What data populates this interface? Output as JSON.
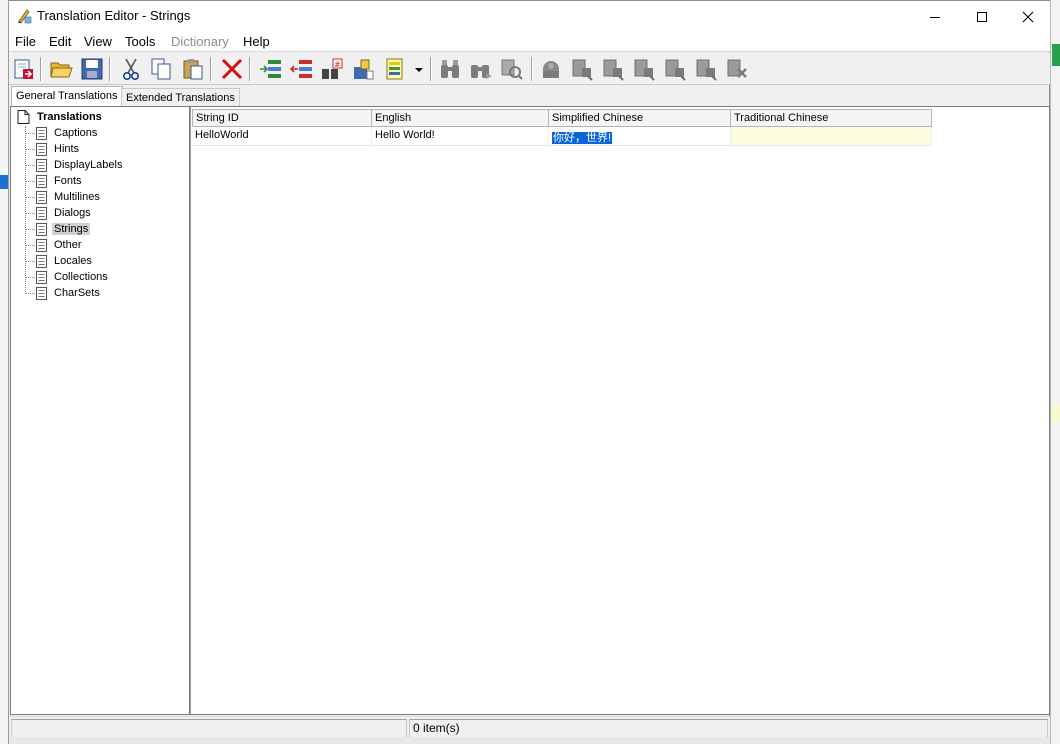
{
  "window": {
    "title": "Translation Editor - Strings",
    "minimize": "—",
    "maximize": "☐",
    "close": "✕"
  },
  "menu": [
    {
      "label": "File",
      "enabled": true
    },
    {
      "label": "Edit",
      "enabled": true
    },
    {
      "label": "View",
      "enabled": true
    },
    {
      "label": "Tools",
      "enabled": true
    },
    {
      "label": "Dictionary",
      "enabled": false
    },
    {
      "label": "Help",
      "enabled": true
    }
  ],
  "toolbar": {
    "buttons": [
      {
        "icon": "exit-icon",
        "enabled": true
      },
      {
        "icon": "open-folder-icon",
        "enabled": true
      },
      {
        "icon": "save-icon",
        "enabled": true
      },
      {
        "icon": "cut-icon",
        "enabled": true
      },
      {
        "icon": "copy-icon",
        "enabled": true
      },
      {
        "icon": "paste-icon",
        "enabled": true
      },
      {
        "icon": "delete-icon",
        "enabled": true
      },
      {
        "icon": "add-item-icon",
        "enabled": true
      },
      {
        "icon": "remove-item-icon",
        "enabled": true
      },
      {
        "icon": "replace-icon",
        "enabled": true
      },
      {
        "icon": "clear-icon",
        "enabled": true
      },
      {
        "icon": "highlight-dropdown-icon",
        "enabled": true
      },
      {
        "icon": "find-icon",
        "enabled": false
      },
      {
        "icon": "find-next-icon",
        "enabled": false
      },
      {
        "icon": "find-replace-icon",
        "enabled": false
      },
      {
        "icon": "translate-icon",
        "enabled": false
      },
      {
        "icon": "translate-row-icon",
        "enabled": false
      },
      {
        "icon": "translate-column-icon",
        "enabled": false
      },
      {
        "icon": "translate-all-icon",
        "enabled": false
      },
      {
        "icon": "translate-selection-icon",
        "enabled": false
      },
      {
        "icon": "translate-next-icon",
        "enabled": false
      },
      {
        "icon": "translate-clear-icon",
        "enabled": false
      }
    ]
  },
  "tabs": [
    {
      "label": "General Translations",
      "active": true
    },
    {
      "label": "Extended Translations",
      "active": false
    }
  ],
  "tree": {
    "root": "Translations",
    "items": [
      {
        "label": "Captions",
        "selected": false
      },
      {
        "label": "Hints",
        "selected": false
      },
      {
        "label": "DisplayLabels",
        "selected": false
      },
      {
        "label": "Fonts",
        "selected": false
      },
      {
        "label": "Multilines",
        "selected": false
      },
      {
        "label": "Dialogs",
        "selected": false
      },
      {
        "label": "Strings",
        "selected": true
      },
      {
        "label": "Other",
        "selected": false
      },
      {
        "label": "Locales",
        "selected": false
      },
      {
        "label": "Collections",
        "selected": false
      },
      {
        "label": "CharSets",
        "selected": false
      }
    ]
  },
  "grid": {
    "columns": [
      "String ID",
      "English",
      "Simplified Chinese",
      "Traditional Chinese"
    ],
    "rows": [
      {
        "string_id": "HelloWorld",
        "english": "Hello World!",
        "simplified_chinese": "你好，世界!",
        "traditional_chinese": ""
      }
    ]
  },
  "status": {
    "count": "0 item(s)"
  }
}
